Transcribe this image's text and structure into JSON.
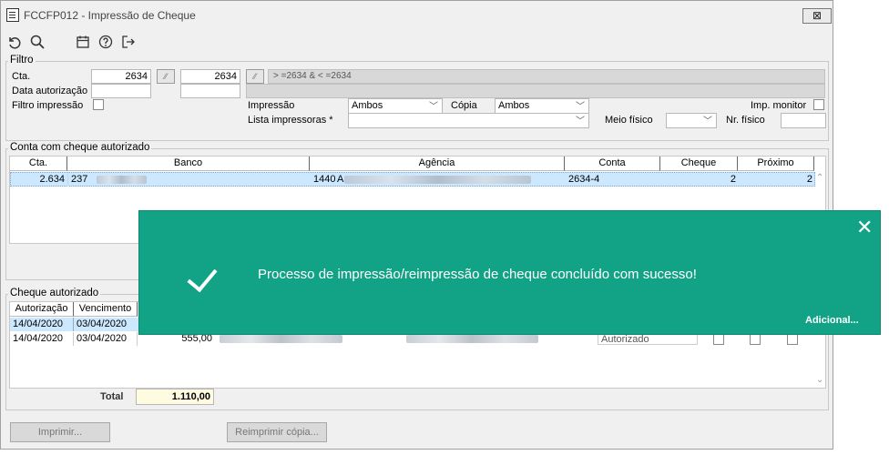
{
  "window": {
    "title": "FCCFP012 - Impressão de Cheque",
    "close_label": "⊠"
  },
  "toolbar": {
    "icons": [
      "undo-icon",
      "search-icon",
      "calendar-icon",
      "help-icon",
      "exit-icon"
    ]
  },
  "filtro": {
    "legend": "Filtro",
    "cta_label": "Cta.",
    "cta_from": "2634",
    "cta_to": "2634",
    "cta_expression": "> =2634 & < =2634",
    "data_label": "Data autorização",
    "filtro_impressao_label": "Filtro impressão",
    "impressao_label": "Impressão",
    "impressao_value": "Ambos",
    "copia_label": "Cópia",
    "copia_value": "Ambos",
    "imp_monitor_label": "Imp. monitor",
    "lista_impressoras_label": "Lista impressoras *",
    "lista_impressoras_value": "",
    "meio_fisico_label": "Meio físico",
    "meio_fisico_value": "",
    "nr_fisico_label": "Nr. físico",
    "nr_fisico_value": ""
  },
  "conta_grid": {
    "legend": "Conta com cheque autorizado",
    "headers": [
      "Cta.",
      "Banco",
      "Agência",
      "Conta",
      "Cheque",
      "Próximo"
    ],
    "rows": [
      {
        "cta": "2.634",
        "banco_code": "237",
        "agencia_code": "1440",
        "agencia_prefix": "A",
        "conta": "2634-4",
        "cheque": "2",
        "proximo": "2"
      }
    ]
  },
  "cheque_grid": {
    "legend": "Cheque autorizado",
    "headers": [
      "Autorização",
      "Vencimento"
    ],
    "rows": [
      {
        "autorizacao": "14/04/2020",
        "vencimento": "03/04/2020",
        "valor": "",
        "status": ""
      },
      {
        "autorizacao": "14/04/2020",
        "vencimento": "03/04/2020",
        "valor": "555,00",
        "status": "Autorizado"
      }
    ],
    "total_label": "Total",
    "total_value": "1.110,00"
  },
  "buttons": {
    "imprimir": "Imprimir...",
    "reimprimir": "Reimprimir cópia..."
  },
  "toast": {
    "message": "Processo de impressão/reimpressão de cheque concluído com sucesso!",
    "more_link": "Adicional...",
    "close": "✕"
  },
  "colors": {
    "toast_bg": "#12a386",
    "selected_row": "#cce8ff"
  }
}
